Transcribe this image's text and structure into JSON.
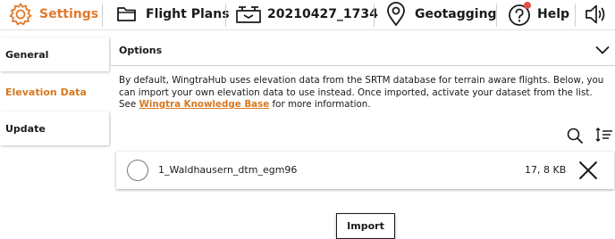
{
  "topbar": {
    "settings_label": "Settings",
    "flight_plans_label": "Flight Plans",
    "flight_id": "20210427_1734",
    "geotagging_label": "Geotagging",
    "help_label": "Help"
  },
  "icons": {
    "settings": "gear-icon",
    "flight_plans": "folder-icon",
    "flight": "drone-icon",
    "geotagging": "location-pin-icon",
    "help": "help-icon",
    "sound": "speaker-icon"
  },
  "colors": {
    "accent": "#e07a2c",
    "notification_dot": "#e0524a"
  },
  "sidebar": {
    "items": [
      {
        "label": "General"
      },
      {
        "label": "Elevation Data",
        "active": true
      },
      {
        "label": "Update"
      }
    ]
  },
  "main": {
    "options_title": "Options",
    "description_before": "By default, WingtraHub uses elevation data from the SRTM database for terrain aware flights. Below, you can import your own elevation data to use instead. Once imported, activate your dataset from the list. See ",
    "description_link": "Wingtra Knowledge Base",
    "description_after": " for more information.",
    "datasets": [
      {
        "name": "1_Waldhausern_dtm_egm96",
        "size": "17, 8 KB",
        "selected": false
      }
    ],
    "import_label": "Import"
  }
}
